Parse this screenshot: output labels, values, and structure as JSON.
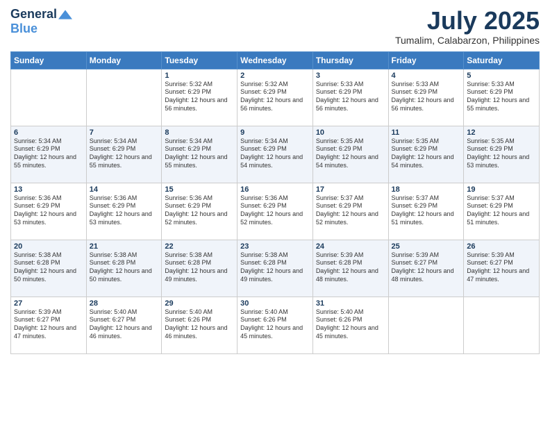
{
  "header": {
    "logo_general": "General",
    "logo_blue": "Blue",
    "month_title": "July 2025",
    "location": "Tumalim, Calabarzon, Philippines"
  },
  "weekdays": [
    "Sunday",
    "Monday",
    "Tuesday",
    "Wednesday",
    "Thursday",
    "Friday",
    "Saturday"
  ],
  "weeks": [
    [
      {
        "day": "",
        "info": ""
      },
      {
        "day": "",
        "info": ""
      },
      {
        "day": "1",
        "info": "Sunrise: 5:32 AM\nSunset: 6:29 PM\nDaylight: 12 hours and 56 minutes."
      },
      {
        "day": "2",
        "info": "Sunrise: 5:32 AM\nSunset: 6:29 PM\nDaylight: 12 hours and 56 minutes."
      },
      {
        "day": "3",
        "info": "Sunrise: 5:33 AM\nSunset: 6:29 PM\nDaylight: 12 hours and 56 minutes."
      },
      {
        "day": "4",
        "info": "Sunrise: 5:33 AM\nSunset: 6:29 PM\nDaylight: 12 hours and 56 minutes."
      },
      {
        "day": "5",
        "info": "Sunrise: 5:33 AM\nSunset: 6:29 PM\nDaylight: 12 hours and 55 minutes."
      }
    ],
    [
      {
        "day": "6",
        "info": "Sunrise: 5:34 AM\nSunset: 6:29 PM\nDaylight: 12 hours and 55 minutes."
      },
      {
        "day": "7",
        "info": "Sunrise: 5:34 AM\nSunset: 6:29 PM\nDaylight: 12 hours and 55 minutes."
      },
      {
        "day": "8",
        "info": "Sunrise: 5:34 AM\nSunset: 6:29 PM\nDaylight: 12 hours and 55 minutes."
      },
      {
        "day": "9",
        "info": "Sunrise: 5:34 AM\nSunset: 6:29 PM\nDaylight: 12 hours and 54 minutes."
      },
      {
        "day": "10",
        "info": "Sunrise: 5:35 AM\nSunset: 6:29 PM\nDaylight: 12 hours and 54 minutes."
      },
      {
        "day": "11",
        "info": "Sunrise: 5:35 AM\nSunset: 6:29 PM\nDaylight: 12 hours and 54 minutes."
      },
      {
        "day": "12",
        "info": "Sunrise: 5:35 AM\nSunset: 6:29 PM\nDaylight: 12 hours and 53 minutes."
      }
    ],
    [
      {
        "day": "13",
        "info": "Sunrise: 5:36 AM\nSunset: 6:29 PM\nDaylight: 12 hours and 53 minutes."
      },
      {
        "day": "14",
        "info": "Sunrise: 5:36 AM\nSunset: 6:29 PM\nDaylight: 12 hours and 53 minutes."
      },
      {
        "day": "15",
        "info": "Sunrise: 5:36 AM\nSunset: 6:29 PM\nDaylight: 12 hours and 52 minutes."
      },
      {
        "day": "16",
        "info": "Sunrise: 5:36 AM\nSunset: 6:29 PM\nDaylight: 12 hours and 52 minutes."
      },
      {
        "day": "17",
        "info": "Sunrise: 5:37 AM\nSunset: 6:29 PM\nDaylight: 12 hours and 52 minutes."
      },
      {
        "day": "18",
        "info": "Sunrise: 5:37 AM\nSunset: 6:29 PM\nDaylight: 12 hours and 51 minutes."
      },
      {
        "day": "19",
        "info": "Sunrise: 5:37 AM\nSunset: 6:29 PM\nDaylight: 12 hours and 51 minutes."
      }
    ],
    [
      {
        "day": "20",
        "info": "Sunrise: 5:38 AM\nSunset: 6:28 PM\nDaylight: 12 hours and 50 minutes."
      },
      {
        "day": "21",
        "info": "Sunrise: 5:38 AM\nSunset: 6:28 PM\nDaylight: 12 hours and 50 minutes."
      },
      {
        "day": "22",
        "info": "Sunrise: 5:38 AM\nSunset: 6:28 PM\nDaylight: 12 hours and 49 minutes."
      },
      {
        "day": "23",
        "info": "Sunrise: 5:38 AM\nSunset: 6:28 PM\nDaylight: 12 hours and 49 minutes."
      },
      {
        "day": "24",
        "info": "Sunrise: 5:39 AM\nSunset: 6:28 PM\nDaylight: 12 hours and 48 minutes."
      },
      {
        "day": "25",
        "info": "Sunrise: 5:39 AM\nSunset: 6:27 PM\nDaylight: 12 hours and 48 minutes."
      },
      {
        "day": "26",
        "info": "Sunrise: 5:39 AM\nSunset: 6:27 PM\nDaylight: 12 hours and 47 minutes."
      }
    ],
    [
      {
        "day": "27",
        "info": "Sunrise: 5:39 AM\nSunset: 6:27 PM\nDaylight: 12 hours and 47 minutes."
      },
      {
        "day": "28",
        "info": "Sunrise: 5:40 AM\nSunset: 6:27 PM\nDaylight: 12 hours and 46 minutes."
      },
      {
        "day": "29",
        "info": "Sunrise: 5:40 AM\nSunset: 6:26 PM\nDaylight: 12 hours and 46 minutes."
      },
      {
        "day": "30",
        "info": "Sunrise: 5:40 AM\nSunset: 6:26 PM\nDaylight: 12 hours and 45 minutes."
      },
      {
        "day": "31",
        "info": "Sunrise: 5:40 AM\nSunset: 6:26 PM\nDaylight: 12 hours and 45 minutes."
      },
      {
        "day": "",
        "info": ""
      },
      {
        "day": "",
        "info": ""
      }
    ]
  ]
}
